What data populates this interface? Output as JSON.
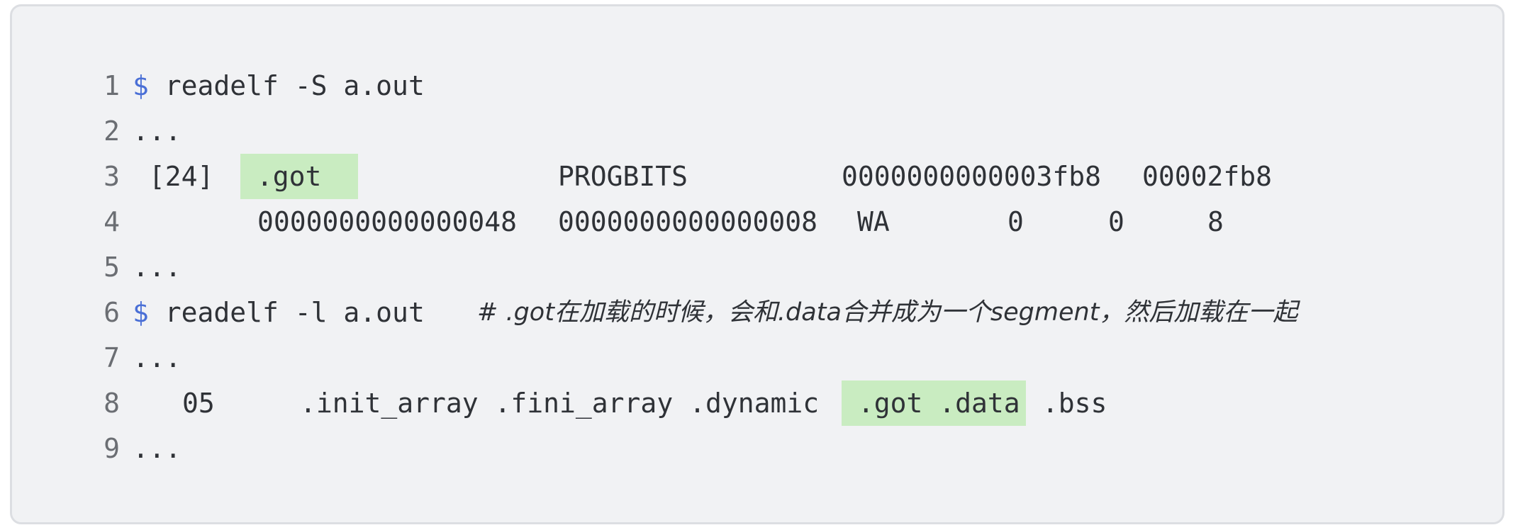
{
  "code_block": {
    "lines": [
      {
        "number": "1",
        "prompt": "$",
        "text": " readelf -S a.out"
      },
      {
        "number": "2",
        "text": "..."
      },
      {
        "number": "3",
        "index": " [24]",
        "highlight": " .got",
        "section_type": "PROGBITS",
        "address": "0000000000003fb8",
        "offset": "00002fb8"
      },
      {
        "number": "4",
        "size": "0000000000000048",
        "entsize": "0000000000000008",
        "flags": "WA",
        "link": "0",
        "info": "0",
        "align": "8"
      },
      {
        "number": "5",
        "text": "..."
      },
      {
        "number": "6",
        "prompt": "$",
        "text": " readelf -l a.out",
        "comment": "# .got在加载的时候，会和.data合并成为一个segment，然后加载在一起"
      },
      {
        "number": "7",
        "text": "..."
      },
      {
        "number": "8",
        "segment_num": "05",
        "before": ".init_array .fini_array .dynamic",
        "highlight": " .got .data",
        "after": " .bss"
      },
      {
        "number": "9",
        "text": "..."
      }
    ]
  },
  "colors": {
    "panel_bg": "#f1f2f4",
    "panel_border": "#dcdee2",
    "highlight": "#c9ecc1",
    "prompt": "#4a6fd6",
    "comment": "#9a9da3",
    "text": "#2f3237",
    "line_number": "#6b6e73"
  }
}
